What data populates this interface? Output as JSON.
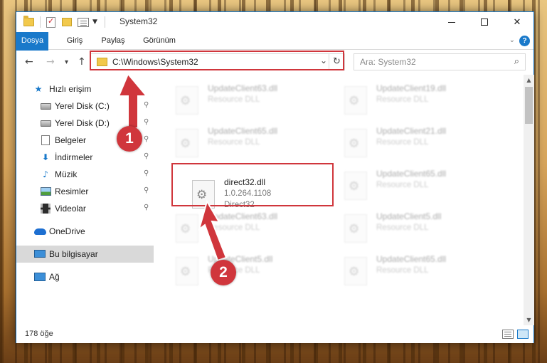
{
  "window": {
    "title": "System32",
    "controls": {
      "minimize": "—",
      "maximize": "☐",
      "close": "✕"
    }
  },
  "ribbon": {
    "tabs": [
      {
        "label": "Dosya",
        "active": true
      },
      {
        "label": "Giriş",
        "active": false
      },
      {
        "label": "Paylaş",
        "active": false
      },
      {
        "label": "Görünüm",
        "active": false
      }
    ],
    "help_label": "?"
  },
  "nav": {
    "back_icon": "←",
    "forward_icon": "→",
    "recent_icon": "▾",
    "up_icon": "↑",
    "address": "C:\\Windows\\System32",
    "address_dropdown_icon": "⌄",
    "refresh_icon": "↻",
    "search_placeholder": "Ara: System32",
    "search_icon": "⌕"
  },
  "sidebar": {
    "items": [
      {
        "label": "Hızlı erişim",
        "icon": "star-icon",
        "pinned": false
      },
      {
        "label": "Yerel Disk (C:)",
        "icon": "drive-icon",
        "pinned": true
      },
      {
        "label": "Yerel Disk (D:)",
        "icon": "drive-icon",
        "pinned": true
      },
      {
        "label": "Belgeler",
        "icon": "documents-icon",
        "pinned": true
      },
      {
        "label": "İndirmeler",
        "icon": "download-icon",
        "pinned": true
      },
      {
        "label": "Müzik",
        "icon": "music-icon",
        "pinned": true
      },
      {
        "label": "Resimler",
        "icon": "pictures-icon",
        "pinned": true
      },
      {
        "label": "Videolar",
        "icon": "videos-icon",
        "pinned": true
      },
      {
        "label": "OneDrive",
        "icon": "cloud-icon",
        "pinned": false
      },
      {
        "label": "Bu bilgisayar",
        "icon": "computer-icon",
        "pinned": false,
        "selected": true
      },
      {
        "label": "Ağ",
        "icon": "network-icon",
        "pinned": false
      }
    ],
    "pin_glyph": "📌"
  },
  "files": [
    {
      "name": "UpdateClient63.dll",
      "line2": "Resource DLL",
      "line3": ""
    },
    {
      "name": "UpdateClient19.dll",
      "line2": "Resource DLL",
      "line3": ""
    },
    {
      "name": "UpdateClient65.dll",
      "line2": "Resource DLL",
      "line3": ""
    },
    {
      "name": "UpdateClient21.dll",
      "line2": "Resource DLL",
      "line3": ""
    },
    {
      "name": "direct32.dll",
      "line2": "1.0.264.1108",
      "line3": "Direct32",
      "highlighted": true
    },
    {
      "name": "UpdateClient65.dll",
      "line2": "Resource DLL",
      "line3": ""
    },
    {
      "name": "UpdateClient63.dll",
      "line2": "Resource DLL",
      "line3": ""
    },
    {
      "name": "UpdateClient5.dll",
      "line2": "Resource DLL",
      "line3": ""
    },
    {
      "name": "UpdateClient5.dll",
      "line2": "Resource DLL",
      "line3": ""
    },
    {
      "name": "UpdateClient65.dll",
      "line2": "Resource DLL",
      "line3": ""
    }
  ],
  "status": {
    "item_count": "178 öğe"
  },
  "annotations": {
    "step1": "1",
    "step2": "2",
    "color": "#d0363c"
  },
  "colors": {
    "accent": "#1979ca",
    "annotation_red": "#d0363c"
  }
}
